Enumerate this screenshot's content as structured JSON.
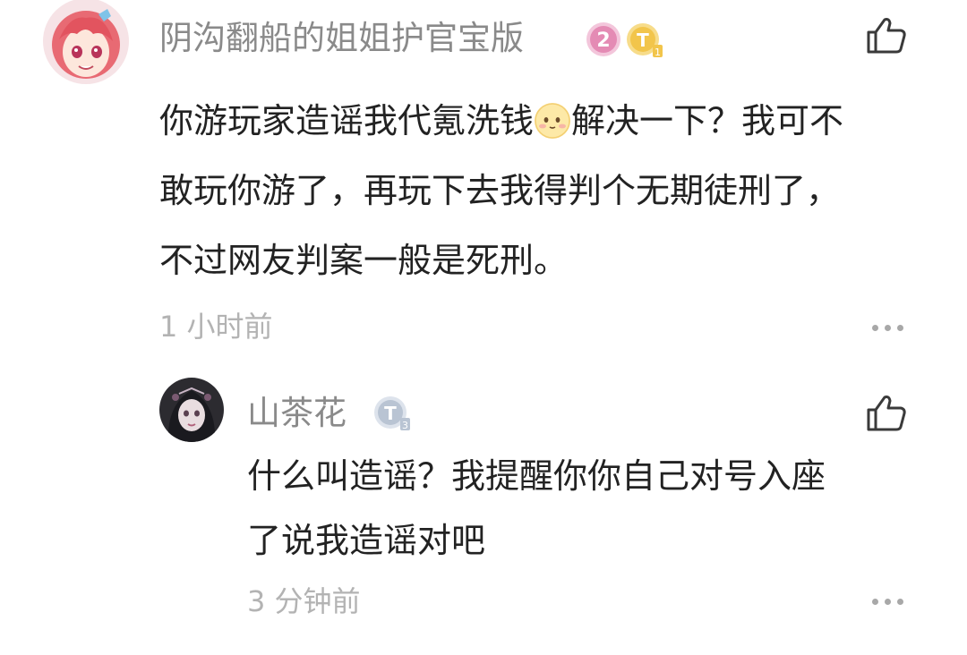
{
  "comment": {
    "username": "阴沟翻船的姐姐护官宝版",
    "level_badge": "2",
    "level_badge_color": "#e48bb4",
    "title_badge": "T",
    "title_badge_sub": "1",
    "title_badge_color": "#f2c54b",
    "text_line1_a": "你游玩家造谣我代氪洗钱",
    "text_line1_b": "解决一下？我可不",
    "text_line2": "敢玩你游了，再玩下去我得判个无期徒刑了，",
    "text_line3": "不过网友判案一般是死刑。",
    "time": "1 小时前",
    "emoji_icon": "shy-smile-emoji-icon",
    "like_icon": "thumbs-up-icon",
    "more_icon": "more-dots-icon"
  },
  "reply": {
    "username": "山茶花",
    "title_badge": "T",
    "title_badge_sub": "3",
    "title_badge_color": "#b9c4d3",
    "text_line1": "什么叫造谣？我提醒你你自己对号入座",
    "text_line2": "了说我造谣对吧",
    "time": "3 分钟前",
    "like_icon": "thumbs-up-icon",
    "more_icon": "more-dots-icon"
  }
}
